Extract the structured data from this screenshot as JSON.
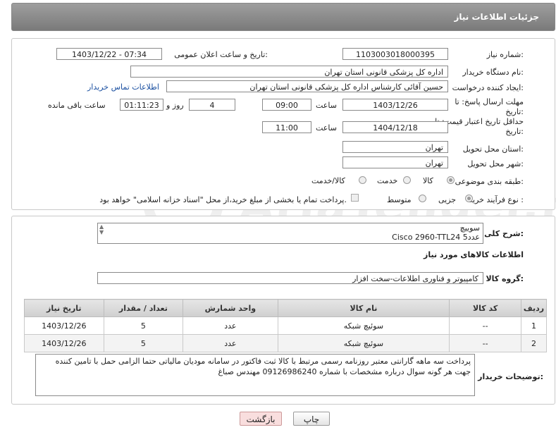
{
  "header": {
    "title": "جزئیات اطلاعات نیاز"
  },
  "fields": {
    "need_number_label": "شماره نیاز:",
    "need_number": "1103003018000395",
    "announce_label": "تاریخ و ساعت اعلان عمومی:",
    "announce_value": "1403/12/22 - 07:34",
    "buyer_label": "نام دستگاه خریدار:",
    "buyer_value": "اداره کل پزشکی قانونی استان تهران",
    "creator_label": "ایجاد کننده درخواست:",
    "creator_value": "حسین آقائی کارشناس اداره کل پزشکی قانونی استان تهران",
    "contact_link": "اطلاعات تماس خریدار",
    "deadline_label": "مهلت ارسال پاسخ: تا تاریخ:",
    "deadline_date": "1403/12/26",
    "time_label": "ساعت",
    "deadline_time": "09:00",
    "days_value": "4",
    "days_label": "روز و",
    "remaining_time": "01:11:23",
    "remaining_label": "ساعت باقی مانده",
    "validity_label": "حداقل تاریخ اعتبار قیمت: تا تاریخ:",
    "validity_date": "1404/12/18",
    "validity_time": "11:00",
    "province_label": "استان محل تحویل:",
    "province_value": "تهران",
    "city_label": "شهر محل تحویل:",
    "city_value": "تهران",
    "category_label": "طبقه بندی موضوعی:",
    "category_options": [
      "کالا",
      "خدمت",
      "کالا/خدمت"
    ],
    "process_label": "نوع فرآیند خرید :",
    "process_options": [
      "جزیی",
      "متوسط"
    ],
    "payment_note": "پرداخت تمام یا بخشی از مبلغ خرید،از محل \"اسناد خزانه اسلامی\" خواهد بود."
  },
  "description": {
    "label": "شرح کلی نیاز:",
    "line1": "سوییچ",
    "line2": "Cisco 2960-TTL24  عدد5"
  },
  "goods_section": {
    "title": "اطلاعات کالاهای مورد نیاز",
    "group_label": "گروه کالا:",
    "group_value": "کامپیوتر و فناوری اطلاعات-سخت افزار"
  },
  "table": {
    "headers": [
      "ردیف",
      "کد کالا",
      "نام کالا",
      "واحد شمارش",
      "تعداد / مقدار",
      "تاریخ نیاز"
    ],
    "rows": [
      [
        "1",
        "--",
        "سوئیچ شبکه",
        "عدد",
        "5",
        "1403/12/26"
      ],
      [
        "2",
        "--",
        "سوئیچ شبکه",
        "عدد",
        "5",
        "1403/12/26"
      ]
    ]
  },
  "buyer_notes": {
    "label": "توضیحات خریدار:",
    "text": "پرداخت سه ماهه گارانتی معتبر روزنامه رسمی مرتبط با کالا ثبت فاکتور در سامانه مودیان مالیاتی حتما الزامی حمل با تامین کننده جهت هر گونه سوال درباره مشخصات با شماره 09126986240 مهندس صباغ"
  },
  "buttons": {
    "print": "چاپ",
    "back": "بازگشت"
  },
  "watermark": "AriaTender.net",
  "colors": {
    "header_bg": "#8a8a8a",
    "link": "#1a4fa0",
    "back_button_bg": "#f9dede"
  }
}
